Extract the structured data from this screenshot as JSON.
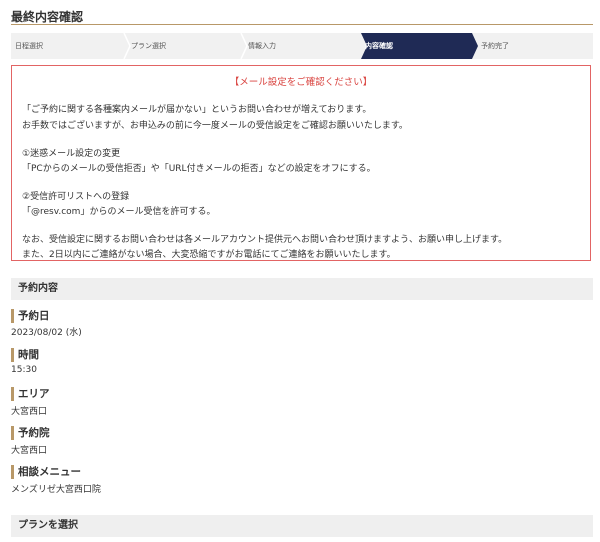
{
  "header": {
    "title": "最終内容確認"
  },
  "steps": [
    {
      "label": "日程選択",
      "active": false
    },
    {
      "label": "プラン選択",
      "active": false
    },
    {
      "label": "情報入力",
      "active": false
    },
    {
      "label": "内容確認",
      "active": true
    },
    {
      "label": "予約完了",
      "active": false
    }
  ],
  "notice": {
    "title": "【メール設定をご確認ください】",
    "lines": [
      "「ご予約に関する各種案内メールが届かない」というお問い合わせが増えております。",
      "お手数ではございますが、お申込みの前に今一度メールの受信設定をご確認お願いいたします。",
      "①迷惑メール設定の変更",
      "「PCからのメールの受信拒否」や「URL付きメールの拒否」などの設定をオフにする。",
      "②受信許可リストへの登録",
      "「@resv.com」からのメール受信を許可する。",
      "なお、受信設定に関するお問い合わせは各メールアカウント提供元へお問い合わせ頂けますよう、お願い申し上げます。",
      "また、2日以内にご連絡がない場合、大変恐縮ですがお電話にてご連絡をお願いいたします。"
    ]
  },
  "reservation": {
    "section_title": "予約内容",
    "fields": [
      {
        "label": "予約日",
        "value": "2023/08/02 (水)"
      },
      {
        "label": "時間",
        "value": "15:30"
      },
      {
        "label": "エリア",
        "value": "大宮西口"
      },
      {
        "label": "予約院",
        "value": "大宮西口"
      },
      {
        "label": "相談メニュー",
        "value": "メンズリゼ大宮西口院"
      }
    ]
  },
  "plan": {
    "section_title": "プランを選択"
  },
  "colors": {
    "accent": "#b89868",
    "active_step": "#1f2a55",
    "notice_border": "#e26464",
    "notice_title": "#d9433f",
    "section_bg": "#efefef"
  }
}
